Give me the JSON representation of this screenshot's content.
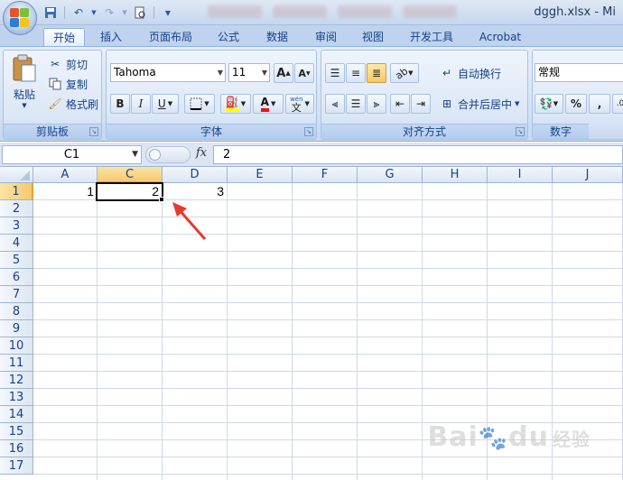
{
  "titlebar": {
    "title": "dggh.xlsx - Mi"
  },
  "tabs": [
    "开始",
    "插入",
    "页面布局",
    "公式",
    "数据",
    "审阅",
    "视图",
    "开发工具",
    "Acrobat"
  ],
  "clipboard": {
    "paste": "粘贴",
    "cut": "剪切",
    "copy": "复制",
    "format_painter": "格式刷",
    "label": "剪贴板"
  },
  "font": {
    "name": "Tahoma",
    "size": "11",
    "label": "字体",
    "bold": "B",
    "italic": "I",
    "underline": "U",
    "grow": "A",
    "shrink": "A",
    "color_a": "A",
    "wen": "wén"
  },
  "alignment": {
    "wrap": "自动换行",
    "merge": "合并后居中",
    "label": "对齐方式"
  },
  "number": {
    "format": "常规",
    "percent": "%",
    "comma": ",",
    "label": "数字"
  },
  "formula_bar": {
    "name_box": "C1",
    "fx": "fx",
    "value": "2"
  },
  "columns": [
    "A",
    "C",
    "D",
    "E",
    "F",
    "G",
    "H",
    "I",
    "J"
  ],
  "rows": [
    "1",
    "2",
    "3",
    "4",
    "5",
    "6",
    "7",
    "8",
    "9",
    "10",
    "11",
    "12",
    "13",
    "14",
    "15",
    "16",
    "17"
  ],
  "cells": {
    "A1": "1",
    "C1": "2",
    "D1": "3"
  },
  "watermark": {
    "text": "Bai",
    "paw": "du",
    "sub": "经验"
  },
  "colors": {
    "selection": "#f8c96c",
    "annotation": "#e8392c"
  }
}
